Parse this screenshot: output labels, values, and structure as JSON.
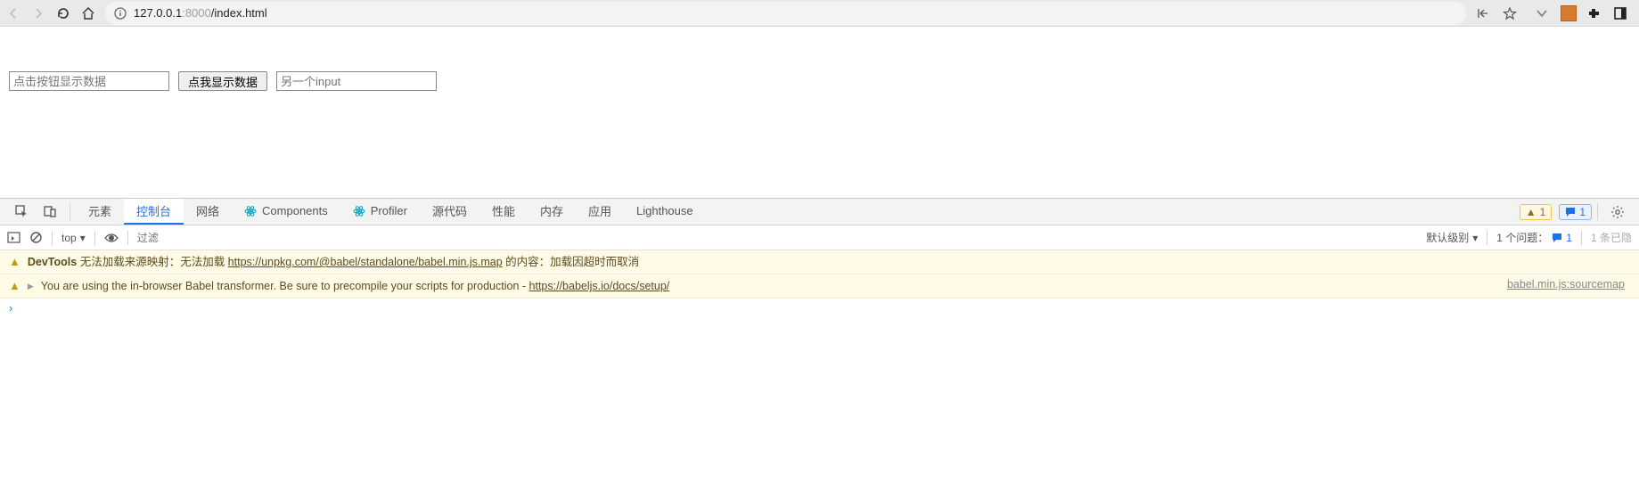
{
  "address": {
    "prefix_icon": "info",
    "host": "127.0.0.1",
    "port": ":8000",
    "path": "/index.html"
  },
  "page": {
    "input1_placeholder": "点击按钮显示数据",
    "button_label": "点我显示数据",
    "input2_placeholder": "另一个input"
  },
  "devtools": {
    "tabs": {
      "elements": "元素",
      "console": "控制台",
      "network": "网络",
      "components": "Components",
      "profiler": "Profiler",
      "sources": "源代码",
      "performance": "性能",
      "memory": "内存",
      "application": "应用",
      "lighthouse": "Lighthouse"
    },
    "warn_count": "1",
    "info_count": "1",
    "toolbar": {
      "context": "top",
      "filter_placeholder": "过滤",
      "level_label": "默认级别",
      "issues_label": "1 个问题：",
      "issues_info_count": "1",
      "hidden_label": "1 条已隐"
    },
    "logs": [
      {
        "type": "warn",
        "prefix": "DevTools",
        "text_before": " 无法加载来源映射：无法加载 ",
        "link": "https://unpkg.com/@babel/standalone/babel.min.js.map",
        "text_after": " 的内容：加载因超时而取消",
        "source": ""
      },
      {
        "type": "warn",
        "expandable": true,
        "text_before": "You are using the in-browser Babel transformer. Be sure to precompile your scripts for production - ",
        "link": "https://babeljs.io/docs/setup/",
        "text_after": "",
        "source": "babel.min.js:sourcemap"
      }
    ]
  }
}
